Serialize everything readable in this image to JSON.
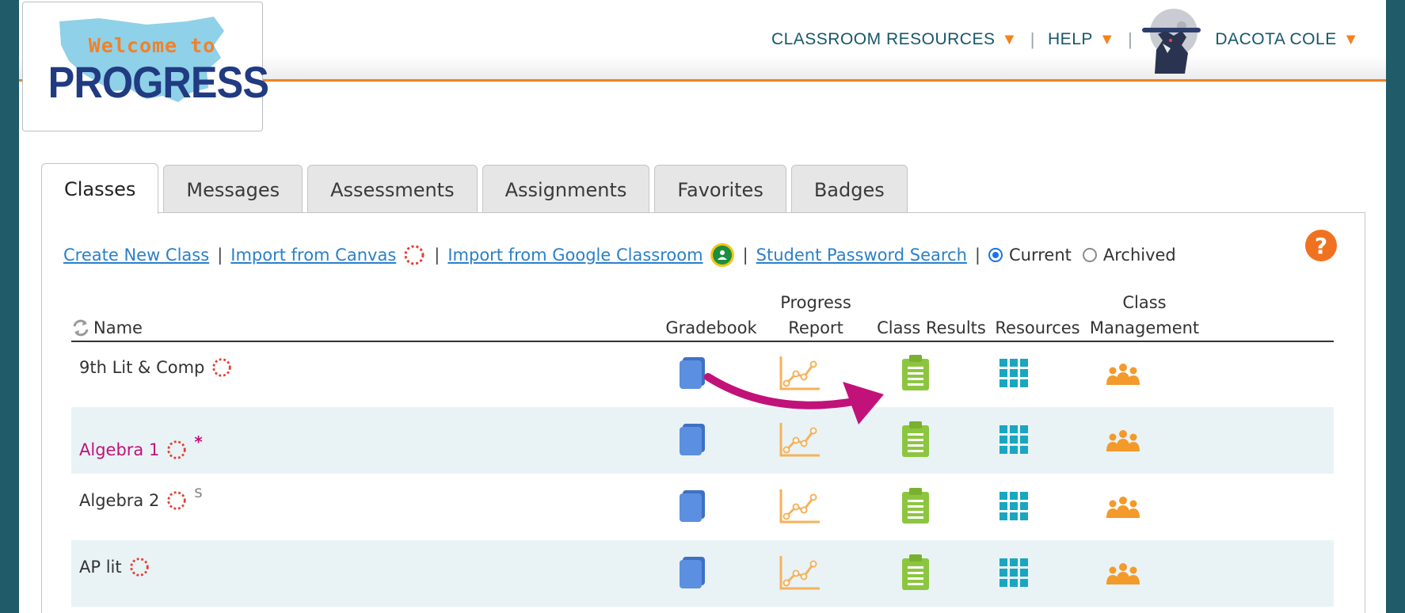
{
  "logo": {
    "welcome": "Welcome to",
    "progress": "PROGRESS"
  },
  "nav": {
    "classroom_resources": "CLASSROOM RESOURCES",
    "help": "HELP",
    "user": "DACOTA COLE"
  },
  "tabs": [
    {
      "label": "Classes",
      "active": true
    },
    {
      "label": "Messages"
    },
    {
      "label": "Assessments"
    },
    {
      "label": "Assignments"
    },
    {
      "label": "Favorites"
    },
    {
      "label": "Badges"
    }
  ],
  "toolbar": {
    "create": "Create New Class",
    "import_canvas": "Import from Canvas",
    "import_google": "Import from Google Classroom",
    "password_search": "Student Password Search",
    "current": "Current",
    "archived": "Archived",
    "selected": "current"
  },
  "help_icon": "?",
  "table": {
    "headers": {
      "name": "Name",
      "gradebook": "Gradebook",
      "progress_1": "Progress",
      "progress_2": "Report",
      "class_results": "Class Results",
      "resources": "Resources",
      "class_mgmt_1": "Class",
      "class_mgmt_2": "Management"
    },
    "rows": [
      {
        "name": "9th Lit & Comp",
        "mark": ""
      },
      {
        "name": "Algebra 1",
        "mark": "*"
      },
      {
        "name": "Algebra 2",
        "mark": "S"
      },
      {
        "name": "AP lit",
        "mark": ""
      }
    ]
  },
  "colors": {
    "accent_orange": "#f08122",
    "nav_teal": "#16576a",
    "link_blue": "#2a80c9",
    "gradebook_blue": "#4f86d9",
    "results_green": "#8cc63f",
    "resources_teal": "#1aa6c0",
    "management_orange": "#f39a2b",
    "highlight_magenta": "#c1127a"
  },
  "icons": {
    "canvas": "canvas-icon",
    "google": "google-classroom-icon",
    "gradebook": "book-icon",
    "progress": "line-chart-icon",
    "results": "clipboard-icon",
    "resources": "grid-icon",
    "management": "people-icon",
    "sort": "refresh-icon"
  }
}
